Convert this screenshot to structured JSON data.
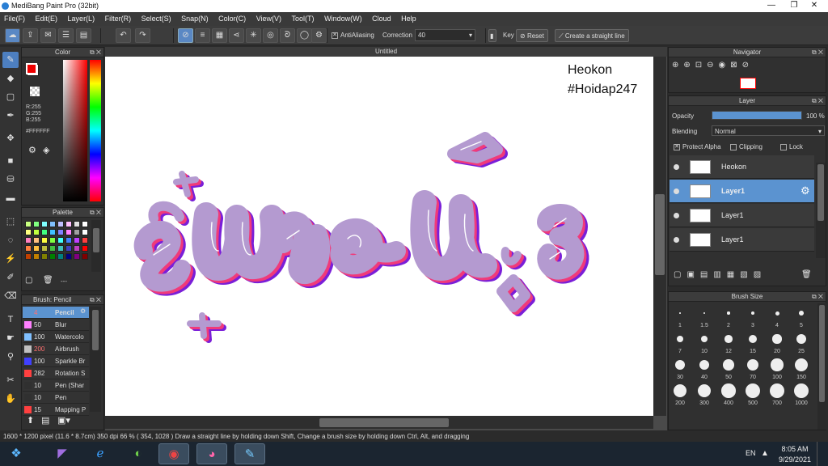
{
  "window": {
    "title": "MediBang Paint Pro (32bit)"
  },
  "menu": [
    "File(F)",
    "Edit(E)",
    "Layer(L)",
    "Filter(R)",
    "Select(S)",
    "Snap(N)",
    "Color(C)",
    "View(V)",
    "Tool(T)",
    "Window(W)",
    "Cloud",
    "Help"
  ],
  "toolbar": {
    "antialiasing_label": "AntiAliasing",
    "correction_label": "Correction",
    "correction_value": "40",
    "key_label": "Key",
    "reset_label": "Reset",
    "straight_line_label": "Create a straight line"
  },
  "canvas": {
    "tab_title": "Untitled",
    "text_line1": "Heokon",
    "text_line2": "#Hoidap247",
    "colors": {
      "fill": "#b49ad0",
      "shadow_red": "#f03a7a",
      "shadow_purple": "#7a1fd8",
      "outline": "#ffffff"
    }
  },
  "color_panel": {
    "title": "Color",
    "r": "R:255",
    "g": "G:255",
    "b": "B:255",
    "hex": "#FFFFFF",
    "fg": "#ff0000",
    "bg": "#ffffff"
  },
  "palette_panel": {
    "title": "Palette",
    "dash": "---",
    "swatches": [
      "#c8ff80",
      "#80ff80",
      "#80ffff",
      "#80c0ff",
      "#c0c0ff",
      "#ffc0ff",
      "#e0e0e0",
      "#ffffff",
      "#ffff80",
      "#c0ff40",
      "#40ff80",
      "#40c0ff",
      "#8080ff",
      "#ff80ff",
      "#a0a0a0",
      "#ffffff",
      "#ff80c0",
      "#ffc080",
      "#ffff40",
      "#80ff40",
      "#40ffff",
      "#4080ff",
      "#c040ff",
      "#ff4040",
      "#ff8040",
      "#ffc040",
      "#c0c040",
      "#40c040",
      "#40c0c0",
      "#4040c0",
      "#c040c0",
      "#ff0000",
      "#c04000",
      "#c08000",
      "#808000",
      "#008000",
      "#008080",
      "#000080",
      "#800080",
      "#800000"
    ]
  },
  "brush_panel": {
    "title": "Brush: Pencil",
    "items": [
      {
        "size": "4",
        "name": "Pencil",
        "color": "#5b93d0"
      },
      {
        "size": "50",
        "name": "Blur",
        "color": "#ff80ff"
      },
      {
        "size": "100",
        "name": "Watercolo",
        "color": "#80c0ff"
      },
      {
        "size": "200",
        "name": "Airbrush",
        "color": "#c0c0c0"
      },
      {
        "size": "100",
        "name": "Sparkle Br",
        "color": "#4040ff"
      },
      {
        "size": "282",
        "name": "Rotation S",
        "color": "#ff4040"
      },
      {
        "size": "10",
        "name": "Pen (Shar",
        "color": "#303030"
      },
      {
        "size": "10",
        "name": "Pen",
        "color": "#303030"
      },
      {
        "size": "15",
        "name": "Mapping P",
        "color": "#ff4040"
      }
    ]
  },
  "navigator": {
    "title": "Navigator"
  },
  "layer_panel": {
    "title": "Layer",
    "opacity_label": "Opacity",
    "opacity_value": "100 %",
    "opacity": 1.0,
    "blending_label": "Blending",
    "blending_value": "Normal",
    "protect_alpha": "Protect Alpha",
    "clipping": "Clipping",
    "lock": "Lock",
    "layers": [
      {
        "name": "Heokon",
        "selected": false
      },
      {
        "name": "Layer1",
        "selected": true
      },
      {
        "name": "Layer1",
        "selected": false
      },
      {
        "name": "Layer1",
        "selected": false
      }
    ]
  },
  "brush_size_panel": {
    "title": "Brush Size",
    "sizes": [
      "1",
      "1.5",
      "2",
      "3",
      "4",
      "5",
      "7",
      "10",
      "12",
      "15",
      "20",
      "25",
      "30",
      "40",
      "50",
      "70",
      "100",
      "150",
      "200",
      "300",
      "400",
      "500",
      "700",
      "1000"
    ]
  },
  "status": {
    "canvas_size": "1600 * 1200 pixel",
    "physical": "(11.6 * 8.7cm)",
    "dpi": "350 dpi",
    "zoom": "66 %",
    "coords": "( 354, 1028 )",
    "hint": "Draw a straight line by holding down Shift, Change a brush size by holding down Ctrl, Alt, and dragging"
  },
  "taskbar": {
    "lang": "EN",
    "time": "8:05 AM",
    "date": "9/29/2021"
  }
}
